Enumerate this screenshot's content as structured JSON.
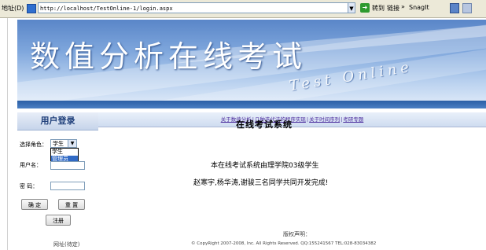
{
  "browser": {
    "address_label": "地址(D)",
    "url": "http://localhost/TestOnline-1/login.aspx",
    "go_label": "转到",
    "links_label": "链接",
    "chevron": "»",
    "snagit_label": "SnagIt"
  },
  "banner": {
    "title": "数值分析在线考试",
    "subtitle": "Test Online"
  },
  "login": {
    "header": "用户登录",
    "role_label": "选择角色：",
    "role_value": "学生",
    "role_options": [
      "学生",
      "管理员"
    ],
    "username_label": "用户名：",
    "password_label": "密  码：",
    "confirm_button": "确 定",
    "reset_button": "重 置",
    "register_button": "注册"
  },
  "nav": {
    "links": [
      "关于数值分析",
      "几种迭代法的程序实现",
      "关于时间序列",
      "考研专题"
    ],
    "separator": "|"
  },
  "main": {
    "title": "在线考试系统",
    "line1": "本在线考试系统由理学院03级学生",
    "line2": "赵寒宇,杨华涛,谢骏三名同学共同开发完成!"
  },
  "footer": {
    "left": "网址(待定)",
    "copyright_heading": "版权声明：",
    "copyright_text": "© CopyRight 2007-2008, Inc. All Rights Reserved. QQ:155241567  TEL:028-83034382"
  }
}
